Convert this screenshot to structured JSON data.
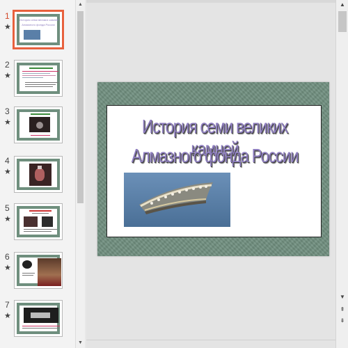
{
  "thumbnails": [
    {
      "number": "1",
      "star": "★",
      "selected": true,
      "title_lines": [
        "История семи великих камней",
        "Алмазного фонда России"
      ]
    },
    {
      "number": "2",
      "star": "★",
      "selected": false
    },
    {
      "number": "3",
      "star": "★",
      "selected": false
    },
    {
      "number": "4",
      "star": "★",
      "selected": false
    },
    {
      "number": "5",
      "star": "★",
      "selected": false
    },
    {
      "number": "6",
      "star": "★",
      "selected": false
    },
    {
      "number": "7",
      "star": "★",
      "selected": false
    }
  ],
  "slide": {
    "title_line_1": "История семи великих камней",
    "title_line_2": "Алмазного фонда России"
  },
  "scroll_icons": {
    "up": "▲",
    "down": "▼",
    "prev_slide": "⇞",
    "next_slide": "⇟"
  },
  "colors": {
    "selected_border": "#e8613d",
    "slide_background": "#6f8e7e",
    "title_color": "#8f7fc0"
  }
}
